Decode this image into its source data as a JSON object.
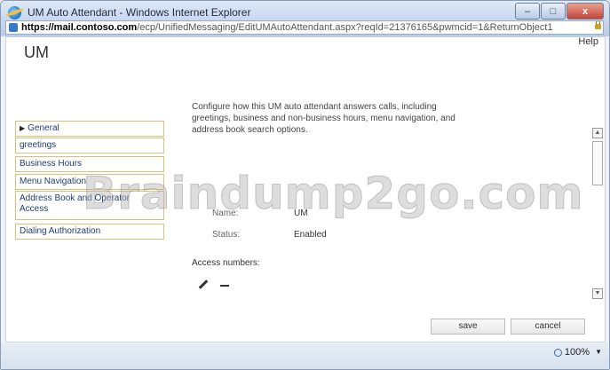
{
  "window": {
    "title": "UM Auto Attendant - Windows Internet Explorer",
    "controls": {
      "minimize": "–",
      "maximize": "□",
      "close": "x"
    }
  },
  "address": {
    "host": "https://mail.contoso.com",
    "path": "/ecp/UnifiedMessaging/EditUMAutoAttendant.aspx?reqId=21376165&pwmcid=1&ReturnObject1"
  },
  "page": {
    "heading": "UM",
    "help": "Help"
  },
  "nav": {
    "items": [
      {
        "label": "General",
        "selected": true
      },
      {
        "label": "greetings"
      },
      {
        "label": "Business Hours"
      },
      {
        "label": "Menu Navigation"
      },
      {
        "label": "Address Book and Operator Access"
      },
      {
        "label": "Dialing Authorization"
      }
    ]
  },
  "main": {
    "description": "Configure how this UM auto attendant answers calls, including greetings, business and non-business hours, menu navigation, and address book search options.",
    "fields": [
      {
        "label": "Name:",
        "value": "UM"
      },
      {
        "label": "Status:",
        "value": "Enabled"
      }
    ],
    "access_numbers_label": "Access numbers:",
    "icons": [
      "pencil-icon",
      "minus-icon"
    ]
  },
  "buttons": {
    "save": "save",
    "cancel": "cancel"
  },
  "status": {
    "zoom": "100%"
  },
  "watermark": "Braindump2go.com",
  "colors": {
    "nav_border": "#d8c27a",
    "nav_text": "#1f3f73"
  }
}
